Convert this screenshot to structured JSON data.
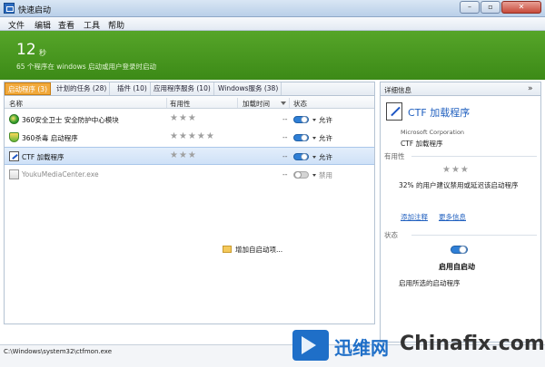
{
  "window": {
    "title": "快速启动"
  },
  "menu": [
    "文件",
    "编辑",
    "查看",
    "工具",
    "帮助"
  ],
  "banner": {
    "count": "12",
    "unit": "秒",
    "description": "65 个程序在 windows 启动或用户登录时启动"
  },
  "tabs": [
    {
      "label": "启动程序 (3)",
      "active": true
    },
    {
      "label": "计划的任务 (28)",
      "active": false
    },
    {
      "label": "插件 (10)",
      "active": false
    },
    {
      "label": "应用程序服务 (10)",
      "active": false
    },
    {
      "label": "Windows服务 (38)",
      "active": false
    }
  ],
  "columns": {
    "name": "名称",
    "usefulness": "有用性",
    "load_time": "加载时间",
    "state": "状态"
  },
  "rows": [
    {
      "name": "360安全卫士 安全防护中心模块",
      "stars": "★★★",
      "load_time": "--",
      "state": "允许",
      "icon": "360-icon",
      "enabled": true
    },
    {
      "name": "360杀毒 启动程序",
      "stars": "★★★★★",
      "load_time": "--",
      "state": "允许",
      "icon": "shield-icon",
      "enabled": true
    },
    {
      "name": "CTF 加载程序",
      "stars": "★★★",
      "load_time": "--",
      "state": "允许",
      "icon": "ctf-icon",
      "enabled": true
    },
    {
      "name": "YoukuMediaCenter.exe",
      "stars": "",
      "load_time": "--",
      "state": "禁用",
      "icon": "exe-icon",
      "enabled": false
    }
  ],
  "add_button": "增加自启动项...",
  "details": {
    "header": "详细信息",
    "collapse": "»",
    "name": "CTF 加载程序",
    "company": "Microsoft Corporation",
    "description": "CTF 加载程序",
    "usefulness_label": "有用性",
    "stars": "★★★",
    "usefulness_text": "32% 的用户建议禁用或延迟该启动程序",
    "link_add_note": "添加注释",
    "link_more": "更多信息",
    "state_label": "状态",
    "state_value": "启用自启动",
    "state_hint": "启用所选的启动程序"
  },
  "status": {
    "path": "C:\\Windows\\system32\\ctfmon.exe"
  },
  "watermark": {
    "cn": "迅维网",
    "en": "Chinafix.com"
  },
  "colors": {
    "banner": "#4a9a20",
    "accent": "#1f5fbf",
    "tab_active": "#f1a93b"
  }
}
